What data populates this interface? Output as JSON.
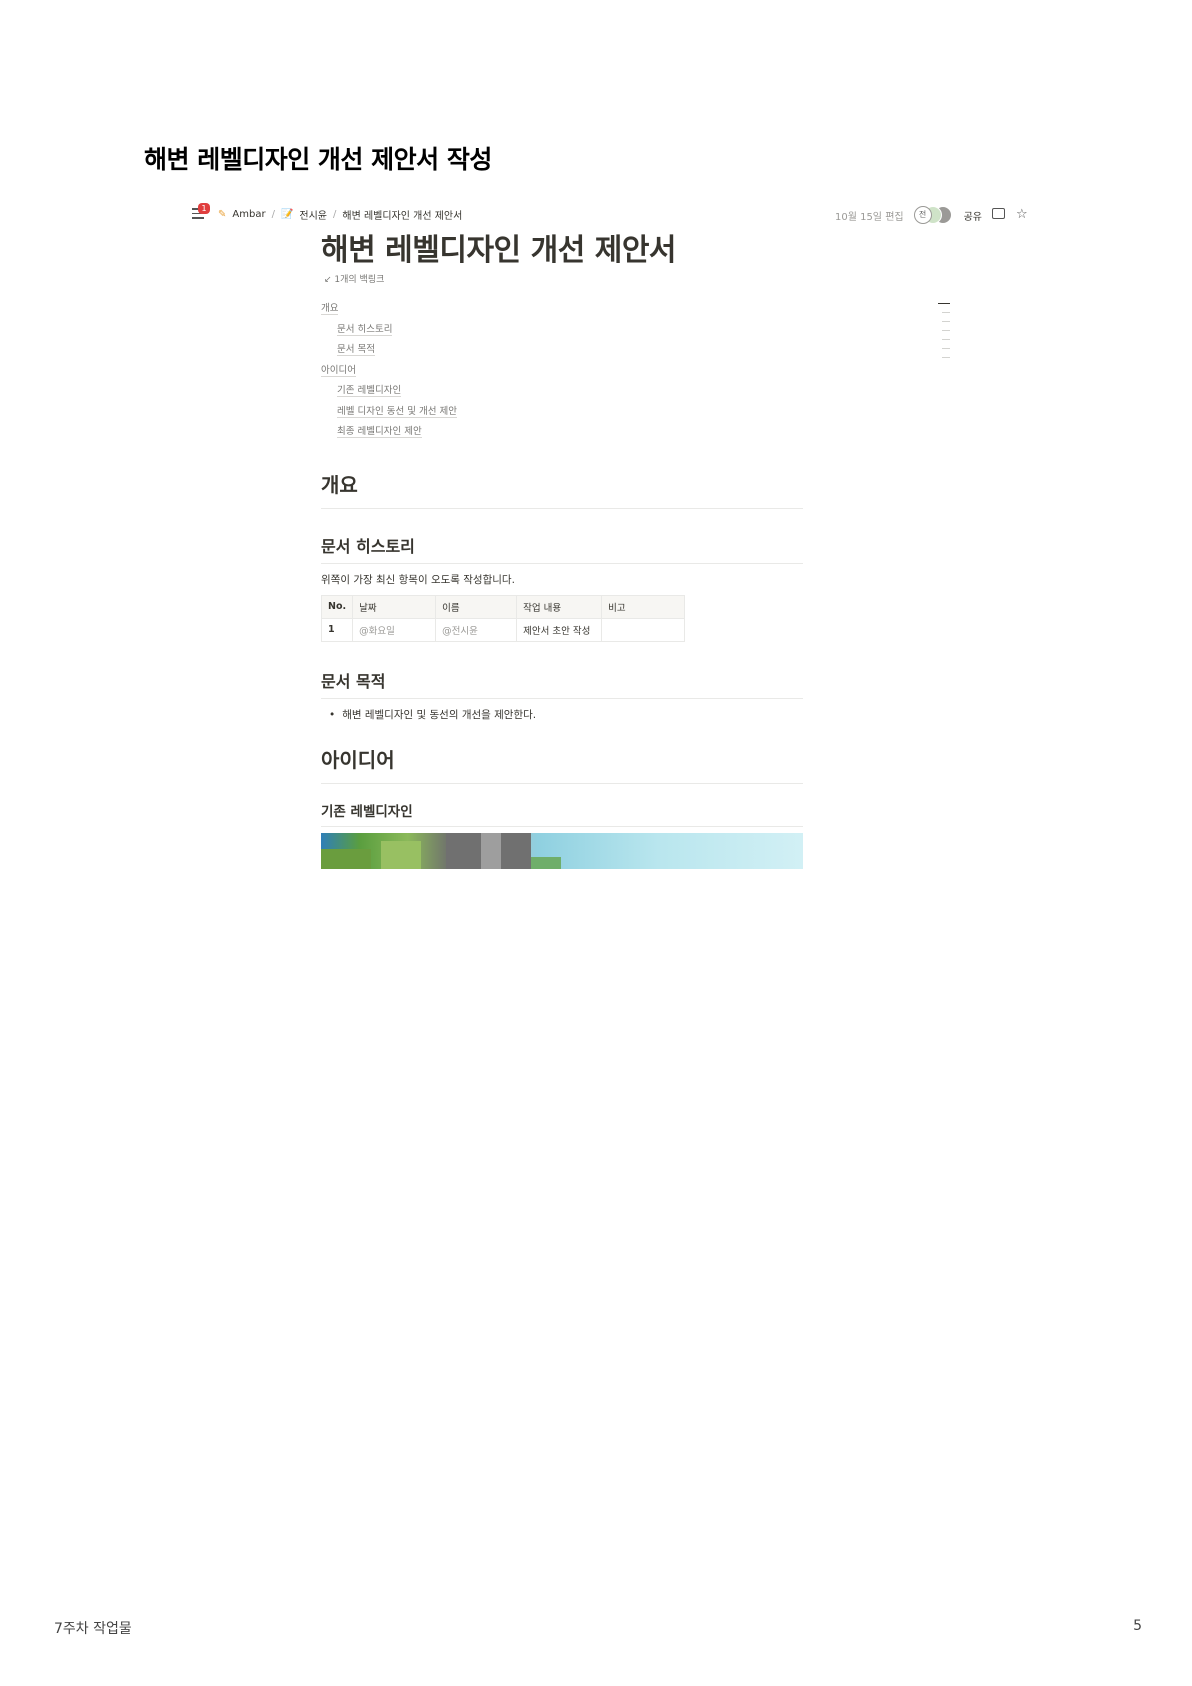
{
  "slide_title": "해변 레벨디자인 개선 제안서 작성",
  "topbar": {
    "badge_count": "1",
    "breadcrumbs": [
      "Ambar",
      "전시윤",
      "해변 레벨디자인 개선 제안서"
    ],
    "edited": "10월 15일 편집",
    "avatar_initial": "전",
    "share": "공유",
    "icons": [
      "menu-icon",
      "comment-icon",
      "star-icon"
    ]
  },
  "page": {
    "title": "해변 레벨디자인 개선 제안서",
    "backlink": "↙ 1개의 백링크",
    "toc": [
      {
        "label": "개요",
        "level": 1
      },
      {
        "label": "문서 히스토리",
        "level": 2
      },
      {
        "label": "문서 목적",
        "level": 2
      },
      {
        "label": "아이디어",
        "level": 1
      },
      {
        "label": "기존 레벨디자인",
        "level": 2
      },
      {
        "label": "레벨 디자인 동선 및 개선 제안",
        "level": 2
      },
      {
        "label": "최종 레벨디자인 제안",
        "level": 2
      }
    ],
    "section_overview": "개요",
    "section_history": "문서 히스토리",
    "history_note": "위쪽이 가장 최신 항목이 오도록 작성합니다.",
    "table": {
      "headers": [
        "No.",
        "날짜",
        "이름",
        "작업 내용",
        "비고"
      ],
      "rows": [
        [
          "1",
          "@화요일",
          "@전시윤",
          "제안서 초안 작성",
          ""
        ]
      ]
    },
    "section_purpose": "문서 목적",
    "purpose_bullet": "해변 레벨디자인 및 동선의 개선을 제안한다.",
    "section_idea": "아이디어",
    "section_existing": "기존 레벨디자인"
  },
  "footer": {
    "left": "7주차 작업물",
    "right": "5"
  }
}
